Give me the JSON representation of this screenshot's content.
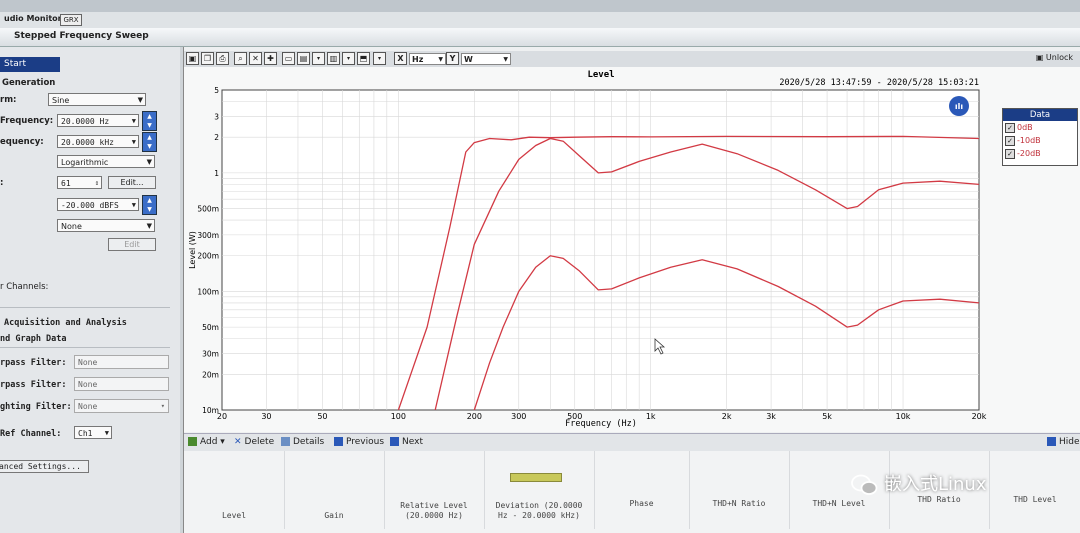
{
  "menubar": {
    "title": "udio Monitor",
    "box": "GRX"
  },
  "sweep": {
    "title": "Stepped Frequency Sweep"
  },
  "left": {
    "start_label": "Start",
    "generation_heading": "Generation",
    "waveform_label": "rm:",
    "waveform_value": "Sine",
    "start_freq_label": "Frequency:",
    "start_freq_value": "20.0000 Hz",
    "stop_freq_label": "equency:",
    "stop_freq_value": "20.0000 kHz",
    "sweep_type_value": "Logarithmic",
    "points_label": ":",
    "points_value": "61",
    "edit1_label": "Edit...",
    "level_value": "-20.000 dBFS",
    "none_value": "None",
    "edit2_label": "Edit",
    "channels_label": "r Channels:",
    "acq_heading": "Acquisition and Analysis",
    "graph_heading": "nd Graph Data",
    "bandpass_label": "rpass Filter:",
    "bandpass_value": "None",
    "lowpass_label": "rpass Filter:",
    "lowpass_value": "None",
    "weighting_label": "ghting Filter:",
    "weighting_value": "None",
    "ref_label": "Ref Channel:",
    "ref_value": "Ch1",
    "advanced_label": "anced Settings..."
  },
  "toolbar": {
    "x_axis": "X",
    "x_unit": "Hz",
    "y_axis": "Y",
    "y_unit": "W",
    "unlock": "Unlock"
  },
  "nav": {
    "add": "Add",
    "delete": "Delete",
    "details": "Details",
    "previous": "Previous",
    "next": "Next",
    "hide": "Hide"
  },
  "thumbnails": [
    {
      "label": "Level"
    },
    {
      "label": "Gain"
    },
    {
      "label": "Relative Level\n(20.0000 Hz)"
    },
    {
      "label": "Deviation (20.0000\nHz - 20.0000 kHz)"
    },
    {
      "label": "Phase"
    },
    {
      "label": "THD+N Ratio"
    },
    {
      "label": "THD+N Level"
    },
    {
      "label": "THD Ratio"
    },
    {
      "label": "THD Level"
    }
  ],
  "watermark": "嵌入式Linux",
  "chart_data": {
    "type": "line",
    "title": "Level",
    "timestamp": "2020/5/28 13:47:59 - 2020/5/28 15:03:21",
    "xlabel": "Frequency (Hz)",
    "ylabel": "Level (W)",
    "x_scale": "log",
    "y_scale": "log",
    "xlim": [
      20,
      20000
    ],
    "ylim": [
      0.01,
      5
    ],
    "x_ticks": [
      {
        "v": 20,
        "label": "20"
      },
      {
        "v": 30,
        "label": "30"
      },
      {
        "v": 50,
        "label": "50"
      },
      {
        "v": 100,
        "label": "100"
      },
      {
        "v": 200,
        "label": "200"
      },
      {
        "v": 300,
        "label": "300"
      },
      {
        "v": 500,
        "label": "500"
      },
      {
        "v": 1000,
        "label": "1k"
      },
      {
        "v": 2000,
        "label": "2k"
      },
      {
        "v": 3000,
        "label": "3k"
      },
      {
        "v": 5000,
        "label": "5k"
      },
      {
        "v": 10000,
        "label": "10k"
      },
      {
        "v": 20000,
        "label": "20k"
      }
    ],
    "y_ticks": [
      {
        "v": 0.01,
        "label": "10m"
      },
      {
        "v": 0.02,
        "label": "20m"
      },
      {
        "v": 0.03,
        "label": "30m"
      },
      {
        "v": 0.05,
        "label": "50m"
      },
      {
        "v": 0.1,
        "label": "100m"
      },
      {
        "v": 0.2,
        "label": "200m"
      },
      {
        "v": 0.3,
        "label": "300m"
      },
      {
        "v": 0.5,
        "label": "500m"
      },
      {
        "v": 1,
        "label": "1"
      },
      {
        "v": 2,
        "label": "2"
      },
      {
        "v": 3,
        "label": "3"
      },
      {
        "v": 5,
        "label": "5"
      }
    ],
    "grid": true,
    "legend": {
      "title": "Data",
      "position": "top-right"
    },
    "color": "#d23a44",
    "series": [
      {
        "name": "0dB",
        "x": [
          100,
          130,
          160,
          185,
          200,
          230,
          280,
          330,
          400,
          500,
          700,
          1000,
          2000,
          5000,
          10000,
          20000
        ],
        "y": [
          0.01,
          0.05,
          0.35,
          1.5,
          1.8,
          1.95,
          1.9,
          2.0,
          1.98,
          2.0,
          2.02,
          2.01,
          2.03,
          2.02,
          2.03,
          1.95
        ]
      },
      {
        "name": "-10dB",
        "x": [
          140,
          170,
          200,
          250,
          300,
          350,
          400,
          450,
          520,
          620,
          700,
          900,
          1200,
          1600,
          2200,
          3200,
          4500,
          6000,
          6600,
          8000,
          10000,
          14000,
          20000
        ],
        "y": [
          0.01,
          0.06,
          0.25,
          0.7,
          1.3,
          1.7,
          1.95,
          1.85,
          1.4,
          1.0,
          1.02,
          1.25,
          1.5,
          1.75,
          1.45,
          1.05,
          0.72,
          0.5,
          0.52,
          0.72,
          0.82,
          0.85,
          0.8
        ]
      },
      {
        "name": "-20dB",
        "x": [
          200,
          230,
          260,
          300,
          350,
          400,
          450,
          520,
          620,
          700,
          900,
          1200,
          1600,
          2200,
          3200,
          4500,
          6000,
          6600,
          8000,
          10000,
          14000,
          20000
        ],
        "y": [
          0.01,
          0.025,
          0.05,
          0.1,
          0.16,
          0.2,
          0.19,
          0.15,
          0.103,
          0.105,
          0.13,
          0.16,
          0.185,
          0.155,
          0.11,
          0.075,
          0.05,
          0.052,
          0.07,
          0.083,
          0.086,
          0.08
        ]
      }
    ]
  }
}
